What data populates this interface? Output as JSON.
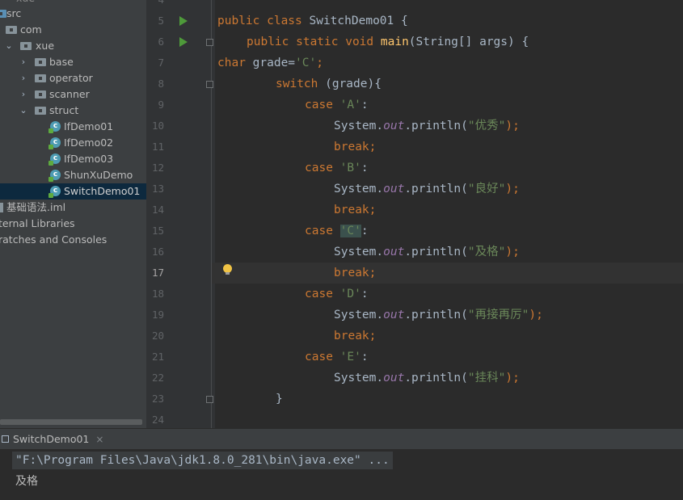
{
  "project_tree": {
    "top_partial": "xue",
    "src": "src",
    "com": "com",
    "xue": "xue",
    "packages": [
      "base",
      "operator",
      "scanner",
      "struct"
    ],
    "classes": [
      "IfDemo01",
      "IfDemo02",
      "IfDemo03",
      "ShunXuDemo",
      "SwitchDemo01"
    ],
    "selected": "SwitchDemo01",
    "iml_file": "基础语法.iml",
    "external_libraries": "ternal Libraries",
    "scratches": "ratches and Consoles"
  },
  "editor": {
    "line_numbers": [
      "4",
      "5",
      "6",
      "7",
      "8",
      "9",
      "10",
      "11",
      "12",
      "13",
      "14",
      "15",
      "16",
      "17",
      "18",
      "19",
      "20",
      "21",
      "22",
      "23",
      "24"
    ],
    "current_line": "17",
    "code": {
      "l5_kw": "public class",
      "l5_rest": " SwitchDemo01 {",
      "l6_kw": "public static void",
      "l6_fn": "main",
      "l6_rest": "(String[] args) {",
      "l7_kw": "char",
      "l7_mid": " grade=",
      "l7_str": "'C'",
      "l7_end": ";",
      "l8_kw": "switch",
      "l8_rest": " (grade){",
      "case_kw": "case",
      "case_a": "'A'",
      "case_b": "'B'",
      "case_c": "'C'",
      "case_d": "'D'",
      "case_e": "'E'",
      "colon": ":",
      "sys": "System.",
      "out": "out",
      "println": ".println(",
      "close": ");",
      "s_a": "\"优秀\"",
      "s_b": "\"良好\"",
      "s_c": "\"及格\"",
      "s_d": "\"再接再厉\"",
      "s_e": "\"挂科\"",
      "break_kw": "break",
      "semi": ";",
      "brace": "}"
    }
  },
  "run_panel": {
    "tab_label": "SwitchDemo01",
    "close_glyph": "×",
    "command": "\"F:\\Program Files\\Java\\jdk1.8.0_281\\bin\\java.exe\" ...",
    "output": "及格"
  }
}
